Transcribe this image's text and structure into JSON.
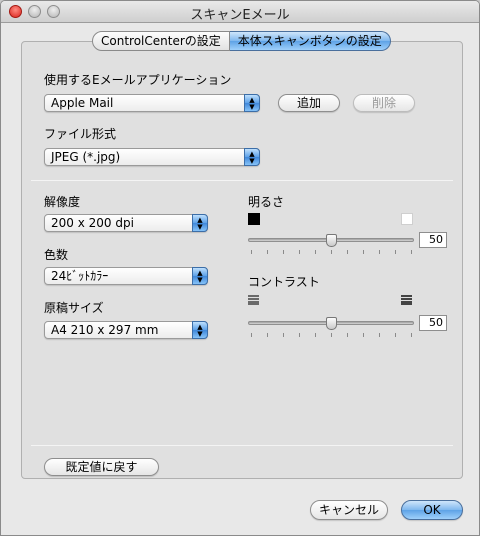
{
  "window": {
    "title": "スキャンEメール"
  },
  "tabs": [
    {
      "label": "ControlCenterの設定",
      "active": false
    },
    {
      "label": "本体スキャンボタンの設定",
      "active": true
    }
  ],
  "email_app": {
    "label": "使用するEメールアプリケーション",
    "value": "Apple Mail",
    "add_label": "追加",
    "delete_label": "削除"
  },
  "file_format": {
    "label": "ファイル形式",
    "value": "JPEG (*.jpg)"
  },
  "resolution": {
    "label": "解像度",
    "value": "200 x 200 dpi"
  },
  "colors": {
    "label": "色数",
    "value": "24ﾋﾞｯﾄｶﾗｰ"
  },
  "document_size": {
    "label": "原稿サイズ",
    "value": "A4  210 x 297 mm"
  },
  "brightness": {
    "label": "明るさ",
    "value": "50",
    "level_percent": 50
  },
  "contrast": {
    "label": "コントラスト",
    "value": "50",
    "level_percent": 50
  },
  "buttons": {
    "restore_defaults": "既定値に戻す",
    "cancel": "キャンセル",
    "ok": "OK"
  },
  "accent_color": "#5ea2e6",
  "icons": [
    "close-icon",
    "minimize-icon",
    "zoom-icon",
    "popup-arrows-icon",
    "black-swatch-icon",
    "white-swatch-icon",
    "low-contrast-icon",
    "high-contrast-icon"
  ]
}
